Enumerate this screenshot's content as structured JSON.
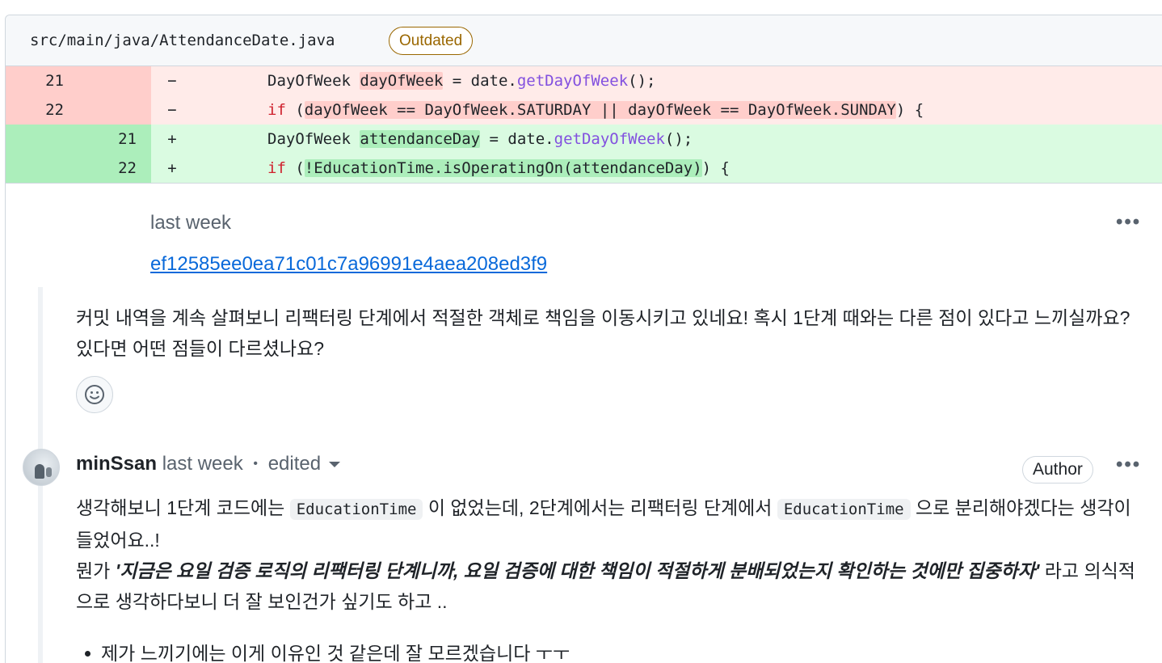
{
  "file": {
    "path": "src/main/java/AttendanceDate.java",
    "status_badge": "Outdated"
  },
  "diff": {
    "deleted": [
      {
        "line": "21",
        "marker": "−",
        "t1": "DayOfWeek ",
        "h1": "dayOfWeek",
        "t2": " = date.",
        "fn": "getDayOfWeek",
        "t3": "();"
      },
      {
        "line": "22",
        "marker": "−",
        "kw": "if",
        "t1": " (",
        "h1": "dayOfWeek == DayOfWeek.SATURDAY || dayOfWeek == DayOfWeek.SUNDAY",
        "t2": ") {"
      }
    ],
    "added": [
      {
        "line": "21",
        "marker": "+",
        "t1": "DayOfWeek ",
        "h1": "attendanceDay",
        "t2": " = date.",
        "fn": "getDayOfWeek",
        "t3": "();"
      },
      {
        "line": "22",
        "marker": "+",
        "kw": "if",
        "t1": " (",
        "h1": "!EducationTime.isOperatingOn(attendanceDay)",
        "t2": ") {"
      }
    ]
  },
  "first_comment": {
    "time": "last week",
    "commit_hash": "ef12585ee0ea71c01c7a96991e4aea208ed3f9",
    "body": "커밋 내역을 계속 살펴보니 리팩터링 단계에서 적절한 객체로 책임을 이동시키고 있네요! 혹시 1단계 때와는 다른 점이 있다고 느끼실까요? 있다면 어떤 점들이 다르셨나요?",
    "more_label": "•••"
  },
  "reply": {
    "author": "minSsan",
    "time": "last week",
    "separator": "•",
    "edited_label": "edited",
    "badge": "Author",
    "more_label": "•••",
    "p1_a": "생각해보니 1단계 코드에는 ",
    "p1_code1": "EducationTime",
    "p1_b": " 이 없었는데, 2단계에서는 리팩터링 단계에서 ",
    "p1_code2": "EducationTime",
    "p1_c": " 으로 분리해야겠다는 생각이 들었어요..!",
    "p2_a": "뭔가 ",
    "p2_emph": "'지금은 요일 검증 로직의 리팩터링 단계니까, 요일 검증에 대한 책임이 적절하게 분배되었는지 확인하는 것에만 집중하자'",
    "p2_b": " 라고 의식적으로 생각하다보니 더 잘 보인건가 싶기도 하고 ..",
    "bullet": "제가 느끼기에는 이게 이유인 것 같은데 잘 모르겠습니다 ㅜㅜ"
  }
}
